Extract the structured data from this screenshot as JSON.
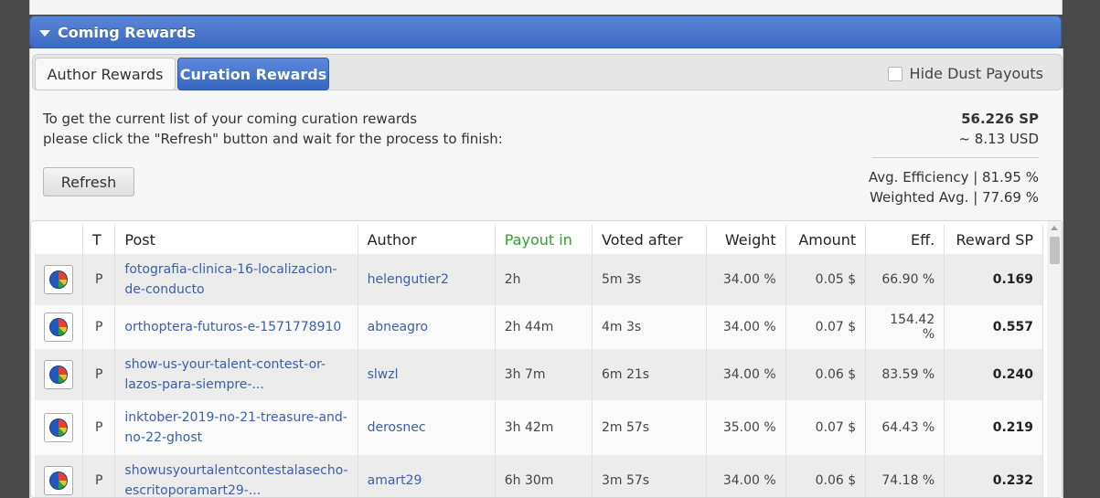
{
  "header": {
    "title": "Coming Rewards"
  },
  "tabs": [
    {
      "label": "Author Rewards",
      "active": false
    },
    {
      "label": "Curation Rewards",
      "active": true
    }
  ],
  "dust": {
    "label": "Hide Dust Payouts",
    "checked": false
  },
  "info": {
    "line1": "To get the current list of your coming curation rewards",
    "line2": "please click the \"Refresh\" button and wait for the process to finish:"
  },
  "stats": {
    "sp": "56.226 SP",
    "usd": "~ 8.13 USD",
    "avg_efficiency": "Avg. Efficiency | 81.95 %",
    "weighted_avg": "Weighted Avg. | 77.69 %"
  },
  "refresh_label": "Refresh",
  "table": {
    "columns": [
      "T",
      "Post",
      "Author",
      "Payout in",
      "Voted after",
      "Weight",
      "Amount",
      "Eff.",
      "Reward SP"
    ],
    "rows": [
      {
        "t": "P",
        "post": "fotografia-clinica-16-localizacion-de-conducto",
        "author": "helengutier2",
        "payout": "2h",
        "voted": "5m 3s",
        "weight": "34.00 %",
        "amount": "0.05 $",
        "eff": "66.90 %",
        "reward": "0.169"
      },
      {
        "t": "P",
        "post": "orthoptera-futuros-e-1571778910",
        "author": "abneagro",
        "payout": "2h 44m",
        "voted": "4m 3s",
        "weight": "34.00 %",
        "amount": "0.07 $",
        "eff": "154.42 %",
        "reward": "0.557"
      },
      {
        "t": "P",
        "post": "show-us-your-talent-contest-or-lazos-para-siempre-...",
        "author": "slwzl",
        "payout": "3h 7m",
        "voted": "6m 21s",
        "weight": "34.00 %",
        "amount": "0.06 $",
        "eff": "83.59 %",
        "reward": "0.240"
      },
      {
        "t": "P",
        "post": "inktober-2019-no-21-treasure-and-no-22-ghost",
        "author": "derosnec",
        "payout": "3h 42m",
        "voted": "2m 57s",
        "weight": "35.00 %",
        "amount": "0.07 $",
        "eff": "64.43 %",
        "reward": "0.219"
      },
      {
        "t": "P",
        "post": "showusyourtalentcontestalasecho-escritoporamart29-...",
        "author": "amart29",
        "payout": "6h 30m",
        "voted": "3m 57s",
        "weight": "34.00 %",
        "amount": "0.06 $",
        "eff": "74.18 %",
        "reward": "0.232"
      }
    ]
  }
}
